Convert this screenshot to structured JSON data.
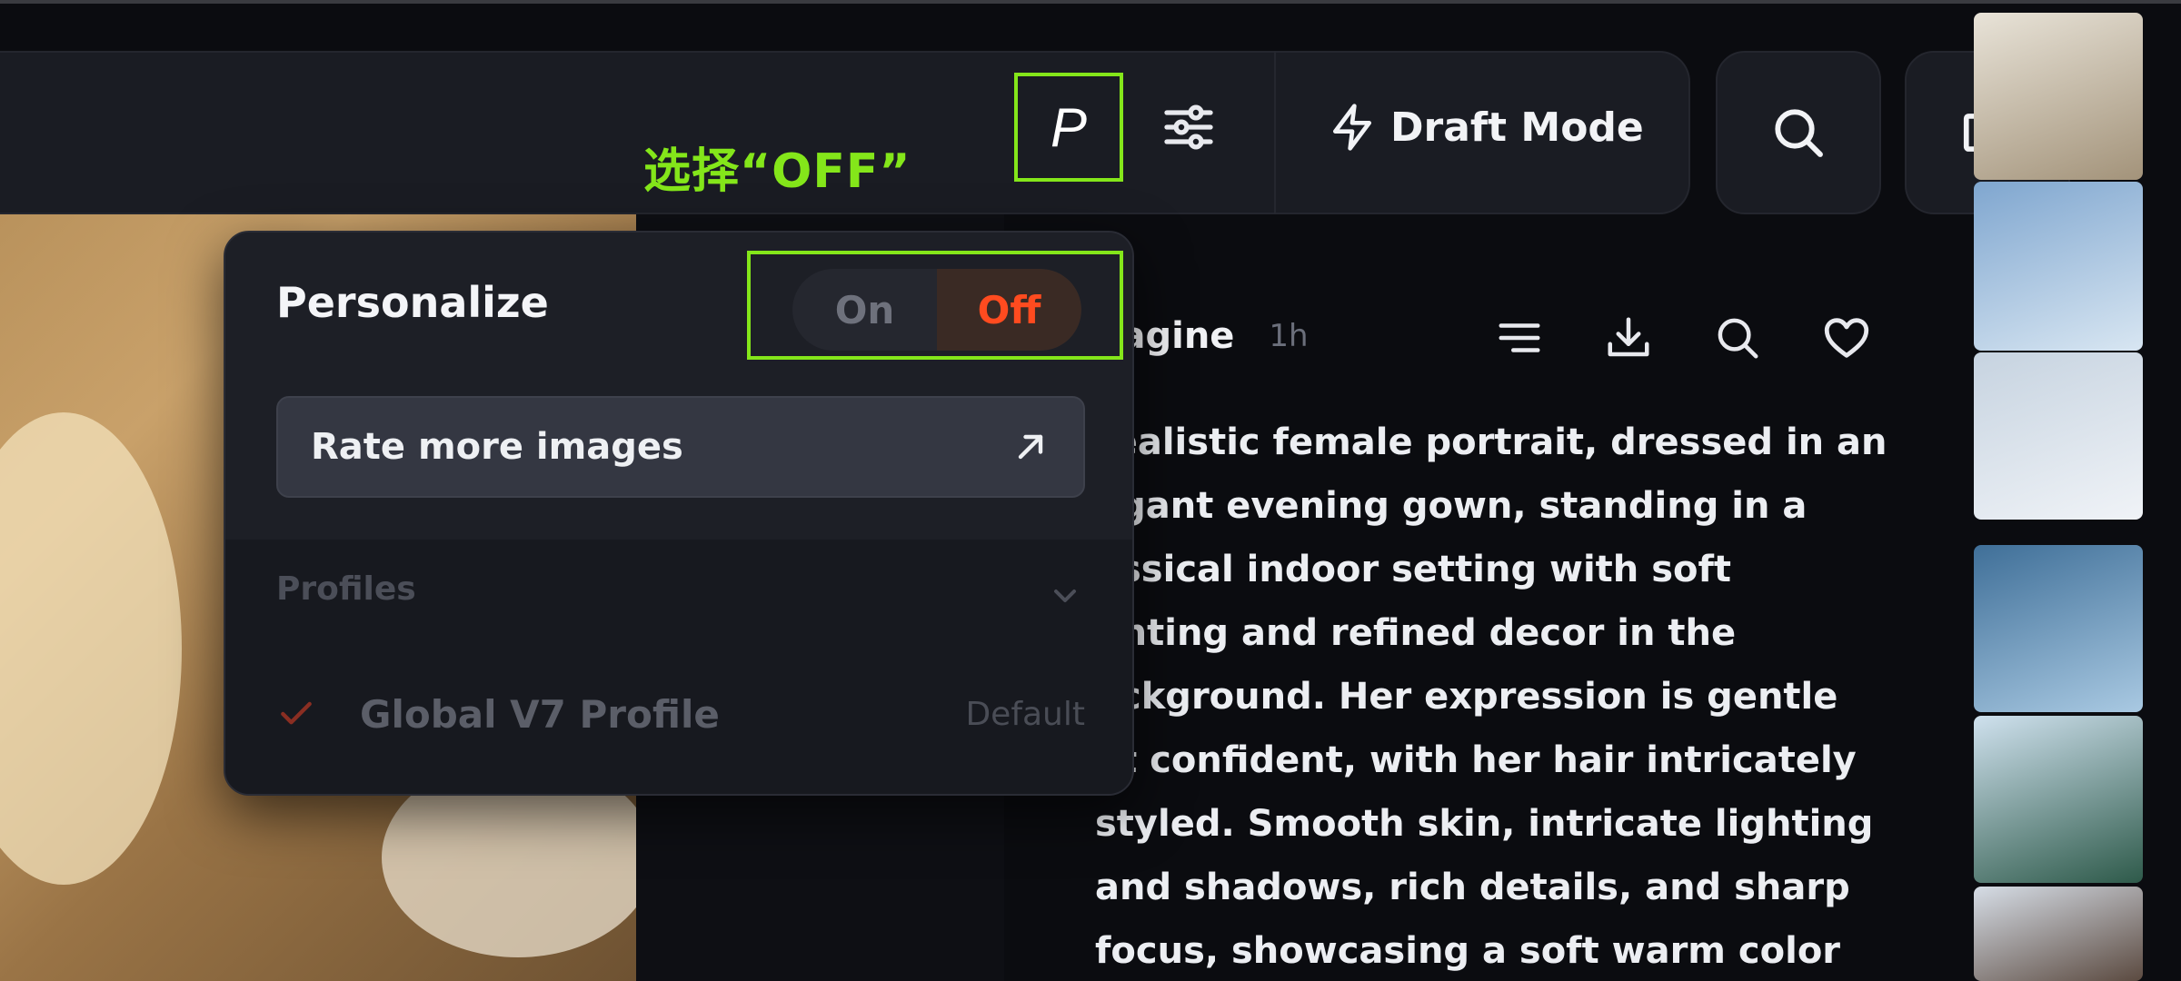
{
  "annotation": {
    "text": "选择“OFF”",
    "color": "#84e61a"
  },
  "toolbar": {
    "personalize_button_label": "P",
    "settings_icon": "sliders-icon",
    "draft_mode_label": "Draft Mode",
    "draft_icon": "lightning-icon",
    "search_icon": "search-icon",
    "folder_icon": "folder-icon"
  },
  "popup": {
    "title": "Personalize",
    "toggle": {
      "on_label": "On",
      "off_label": "Off",
      "selected": "Off"
    },
    "rate_button_label": "Rate more images",
    "rate_button_icon": "arrow-up-right-icon",
    "profiles_label": "Profiles",
    "profiles": [
      {
        "name": "Global V7 Profile",
        "tag": "Default",
        "checked": true
      }
    ]
  },
  "job": {
    "title": "nagine",
    "time": "1h",
    "icons": [
      "list-icon",
      "download-icon",
      "search-icon",
      "heart-icon"
    ],
    "prompt": "realistic female portrait, dressed in an\negant evening gown, standing in a\nassical indoor setting with soft\nghting and refined decor in the\nackground. Her expression is gentle\net confident, with her hair intricately\nstyled. Smooth skin, intricate lighting\nand shadows, rich details, and sharp\nfocus, showcasing a soft warm color"
  },
  "colors": {
    "accent_green": "#84e61a",
    "off_red": "#ff4b1f",
    "panel_bg": "#1a1c23"
  }
}
